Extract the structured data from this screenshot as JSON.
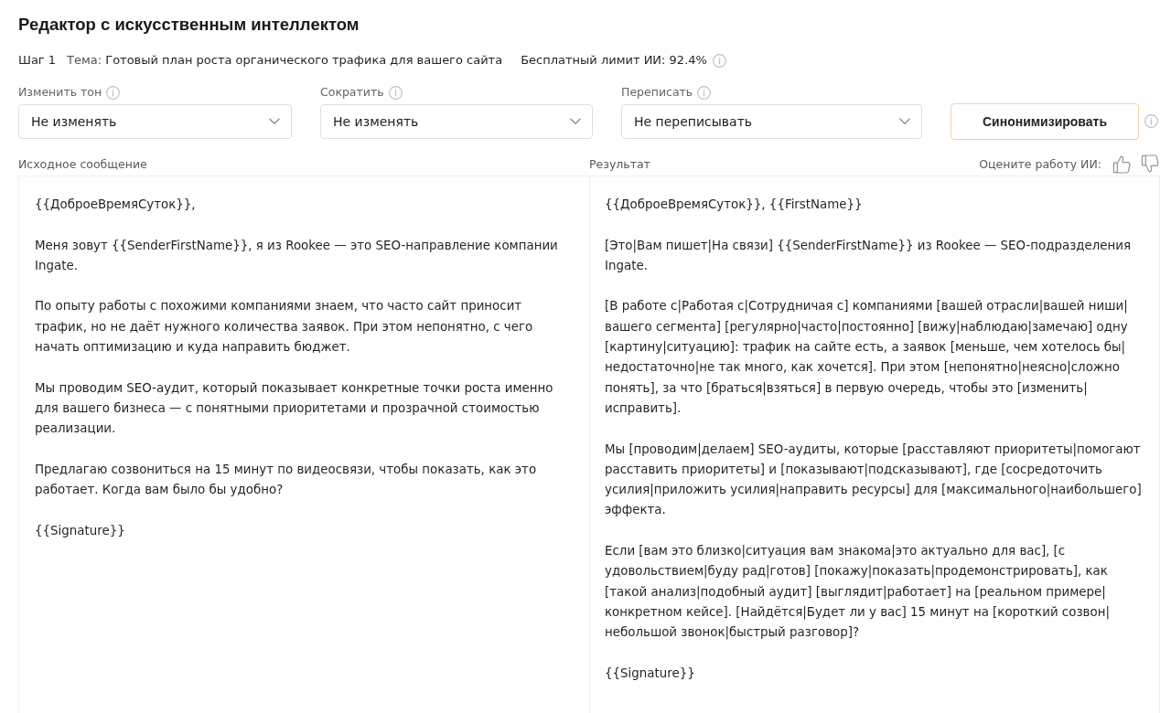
{
  "title": "Редактор с искусственным интеллектом",
  "info_bar": {
    "step": "Шаг 1",
    "topic_label": "Тема:",
    "topic": "Готовый план роста органического трафика для вашего сайта",
    "limit": "Бесплатный лимит ИИ: 92.4%"
  },
  "controls": [
    {
      "label": "Изменить тон",
      "value": "Не изменять"
    },
    {
      "label": "Сократить",
      "value": "Не изменять"
    },
    {
      "label": "Переписать",
      "value": "Не переписывать"
    }
  ],
  "action_button": "Синонимизировать",
  "source": {
    "label": "Исходное сообщение",
    "paragraphs": [
      "{{ДоброеВремяСуток}},",
      "Меня зовут {{SenderFirstName}}, я из Rookee — это SEO-направление компании Ingate.",
      "По опыту работы с похожими компаниями знаем, что часто сайт приносит трафик, но не даёт нужного количества заявок. При этом непонятно, с чего начать оптимизацию и куда направить бюджет.",
      "Мы проводим SEO-аудит, который показывает конкретные точки роста именно для вашего бизнеса — с понятными приоритетами и прозрачной стоимостью реализации.",
      "Предлагаю созвониться на 15 минут по видеосвязи, чтобы показать, как это работает. Когда вам было бы удобно?",
      "{{Signature}}"
    ]
  },
  "result": {
    "label": "Результат",
    "rating_prompt": "Оцените работу ИИ:",
    "paragraphs": [
      "{{ДоброеВремяСуток}}, {{FirstName}}",
      "[Это|Вам пишет|На связи] {{SenderFirstName}} из Rookee — SEO-подразделения Ingate.",
      "[В работе с|Работая с|Сотрудничая с] компаниями [вашей отрасли|вашей ниши|вашего сегмента] [регулярно|часто|постоянно] [вижу|наблюдаю|замечаю] одну [картину|ситуацию]: трафик на сайте есть, а заявок [меньше, чем хотелось бы|недостаточно|не так много, как хочется]. При этом [непонятно|неясно|сложно понять], за что [браться|взяться] в первую очередь, чтобы это [изменить|исправить].",
      "Мы [проводим|делаем] SEO-аудиты, которые [расставляют приоритеты|помогают расставить приоритеты] и [показывают|подсказывают], где [сосредоточить усилия|приложить усилия|направить ресурсы] для [максимального|наибольшего] эффекта.",
      "Если [вам это близко|ситуация вам знакома|это актуально для вас], [с удовольствием|буду рад|готов] [покажу|показать|продемонстрировать], как [такой анализ|подобный аудит] [выглядит|работает] на [реальном примере|конкретном кейсе]. [Найдётся|Будет ли у вас] 15 минут на [короткий созвон|небольшой звонок|быстрый разговор]?",
      "{{Signature}}"
    ]
  }
}
